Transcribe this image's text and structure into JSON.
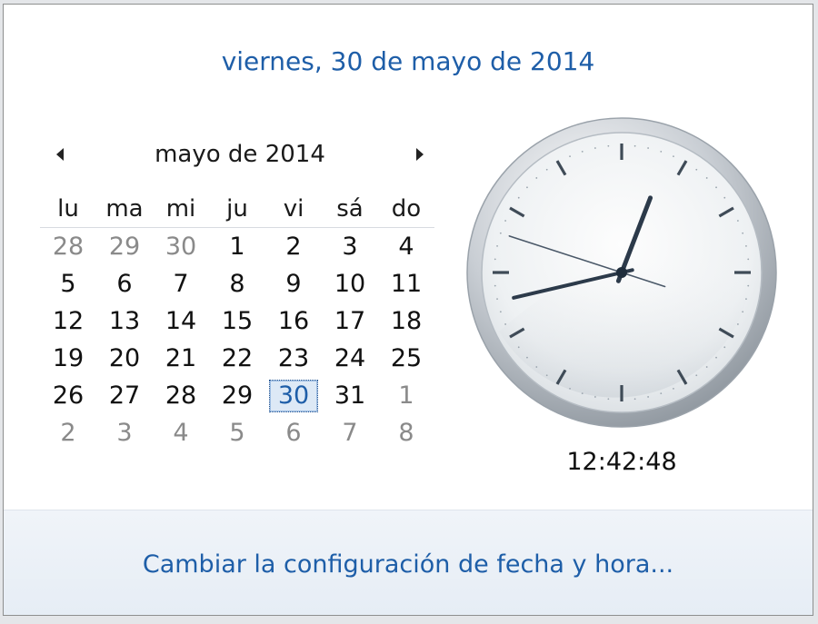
{
  "header": {
    "full_date": "viernes, 30 de mayo de 2014"
  },
  "calendar": {
    "month_title": "mayo de 2014",
    "weekdays": [
      "lu",
      "ma",
      "mi",
      "ju",
      "vi",
      "sá",
      "do"
    ],
    "weeks": [
      [
        {
          "d": "28",
          "o": true
        },
        {
          "d": "29",
          "o": true
        },
        {
          "d": "30",
          "o": true
        },
        {
          "d": "1"
        },
        {
          "d": "2"
        },
        {
          "d": "3"
        },
        {
          "d": "4"
        }
      ],
      [
        {
          "d": "5"
        },
        {
          "d": "6"
        },
        {
          "d": "7"
        },
        {
          "d": "8"
        },
        {
          "d": "9"
        },
        {
          "d": "10"
        },
        {
          "d": "11"
        }
      ],
      [
        {
          "d": "12"
        },
        {
          "d": "13"
        },
        {
          "d": "14"
        },
        {
          "d": "15"
        },
        {
          "d": "16"
        },
        {
          "d": "17"
        },
        {
          "d": "18"
        }
      ],
      [
        {
          "d": "19"
        },
        {
          "d": "20"
        },
        {
          "d": "21"
        },
        {
          "d": "22"
        },
        {
          "d": "23"
        },
        {
          "d": "24"
        },
        {
          "d": "25"
        }
      ],
      [
        {
          "d": "26"
        },
        {
          "d": "27"
        },
        {
          "d": "28"
        },
        {
          "d": "29"
        },
        {
          "d": "30",
          "s": true
        },
        {
          "d": "31"
        },
        {
          "d": "1",
          "o": true
        }
      ],
      [
        {
          "d": "2",
          "o": true
        },
        {
          "d": "3",
          "o": true
        },
        {
          "d": "4",
          "o": true
        },
        {
          "d": "5",
          "o": true
        },
        {
          "d": "6",
          "o": true
        },
        {
          "d": "7",
          "o": true
        },
        {
          "d": "8",
          "o": true
        }
      ]
    ]
  },
  "clock": {
    "time": "12:42:48",
    "hours": 12,
    "minutes": 42,
    "seconds": 48
  },
  "footer": {
    "settings_link": "Cambiar la configuración de fecha y hora..."
  },
  "colors": {
    "link": "#1e5ea8",
    "selected_bg": "#dde9f6",
    "other_month": "#8a8a8a"
  },
  "icons": {
    "prev": "triangle-left-icon",
    "next": "triangle-right-icon"
  }
}
